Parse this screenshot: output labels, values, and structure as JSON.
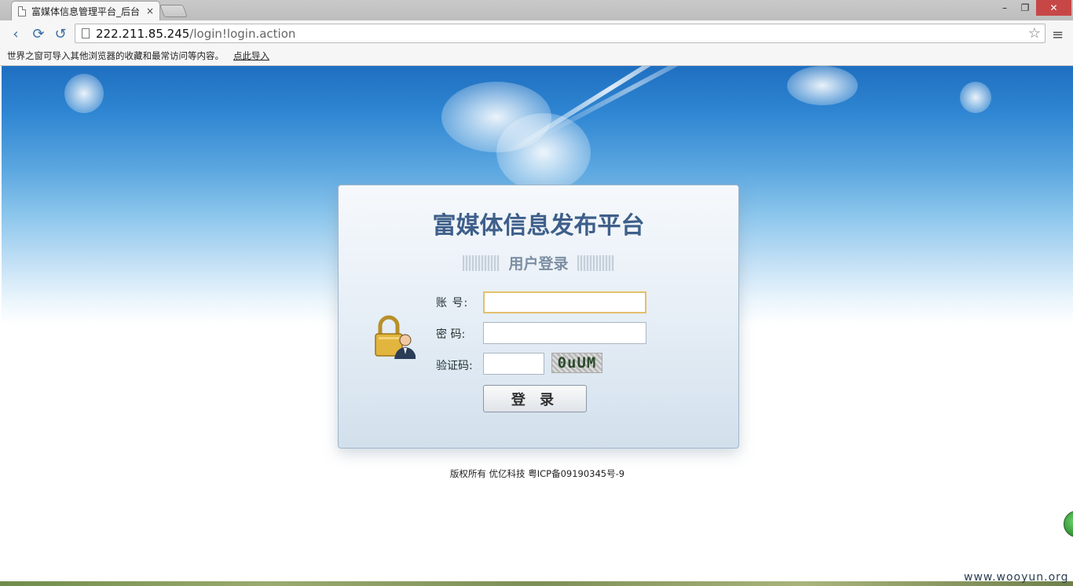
{
  "browser": {
    "tab_title": "富媒体信息管理平台_后台",
    "tab_close": "×",
    "url_host": "222.211.85.245",
    "url_path": "/login!login.action",
    "window_controls": {
      "minimize": "–",
      "maximize": "❐",
      "close": "✕"
    },
    "nav": {
      "back_icon": "‹",
      "forward_icon": "⟳",
      "reload_icon": "↺"
    },
    "star_icon": "☆",
    "menu_icon": "≡"
  },
  "bookmark_bar": {
    "message": "世界之窗可导入其他浏览器的收藏和最常访问等内容。",
    "import_link": "点此导入"
  },
  "login": {
    "platform_title": "富媒体信息发布平台",
    "subtitle": "用户登录",
    "account_label": "账  号:",
    "password_label": "密  码:",
    "captcha_label": "验证码:",
    "account_value": "",
    "password_value": "",
    "captcha_value": "",
    "captcha_image_text": "0uUM",
    "login_button": "登 录"
  },
  "footer": {
    "copyright": "版权所有 优亿科技 粤ICP备09190345号-9"
  },
  "watermark": "www.wooyun.org",
  "colors": {
    "title_blue": "#3e5f8a",
    "sky_top": "#1f6fc0",
    "input_focus_border": "#e3c06a"
  }
}
